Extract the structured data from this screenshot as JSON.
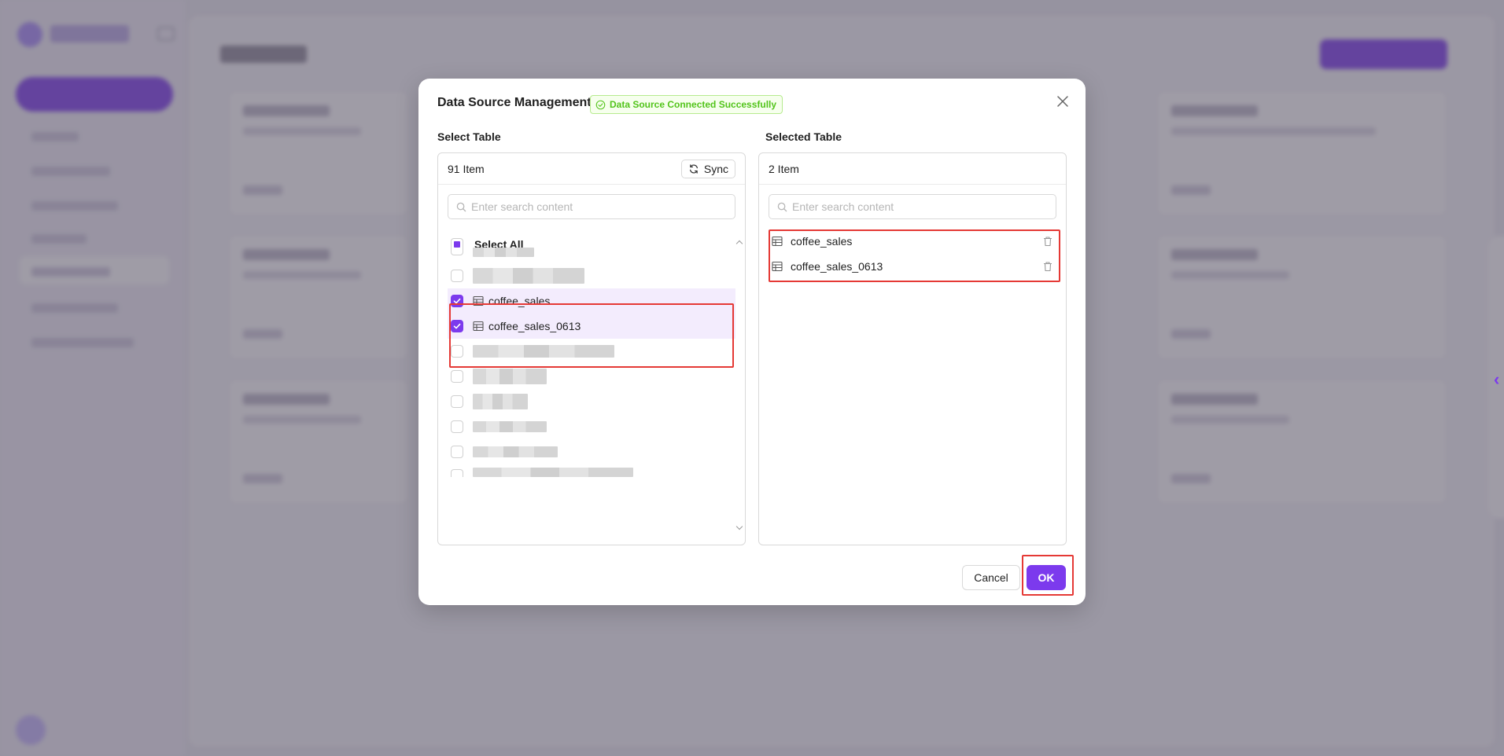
{
  "modal": {
    "title": "Data Source Management",
    "status_text": "Data Source Connected Successfully"
  },
  "left_panel": {
    "label": "Select Table",
    "count_text": "91 Item",
    "sync_label": "Sync",
    "search_placeholder": "Enter search content",
    "select_all_label": "Select All",
    "selected_items": [
      "coffee_sales",
      "coffee_sales_0613"
    ]
  },
  "right_panel": {
    "label": "Selected Table",
    "count_text": "2 Item",
    "search_placeholder": "Enter search content",
    "items": [
      "coffee_sales",
      "coffee_sales_0613"
    ]
  },
  "footer": {
    "cancel_label": "Cancel",
    "ok_label": "OK"
  },
  "colors": {
    "accent": "#7c3aed",
    "success": "#52c41a",
    "highlight": "#e53935"
  }
}
